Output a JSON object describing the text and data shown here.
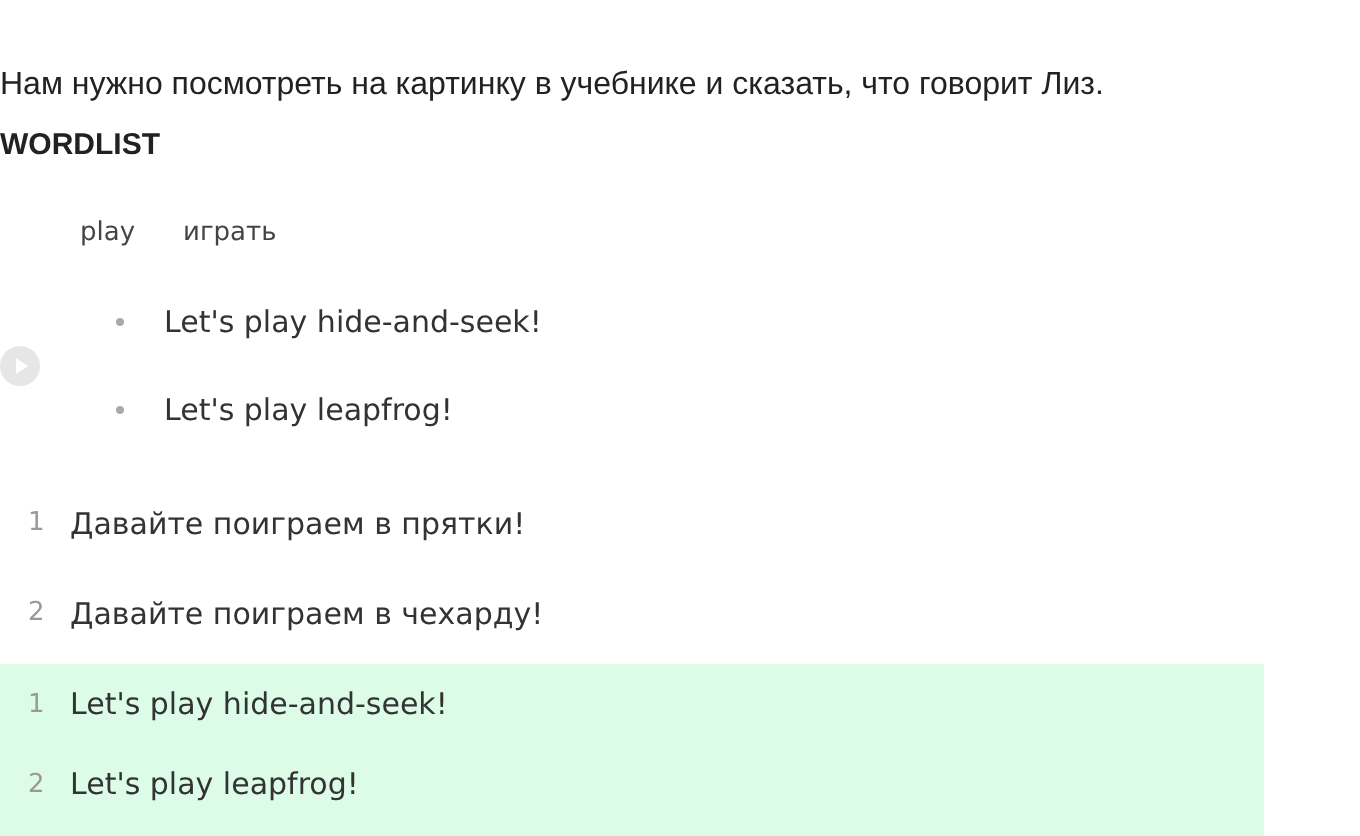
{
  "intro": "Нам нужно посмотреть на картинку в учебнике и сказать, что говорит Лиз.",
  "wordlist_title": "WORDLIST",
  "wordlist": [
    {
      "word": "play",
      "translation": "играть"
    }
  ],
  "examples": [
    "Let's play hide-and-seek!",
    "Let's play leapfrog!"
  ],
  "translation": [
    {
      "number": "1",
      "text": "Давайте поиграем в прятки!"
    },
    {
      "number": "2",
      "text": "Давайте поиграем в чехарду!"
    }
  ],
  "answer": [
    {
      "number": "1",
      "text": "Let's play hide-and-seek!"
    },
    {
      "number": "2",
      "text": "Let's play leapfrog!"
    }
  ]
}
